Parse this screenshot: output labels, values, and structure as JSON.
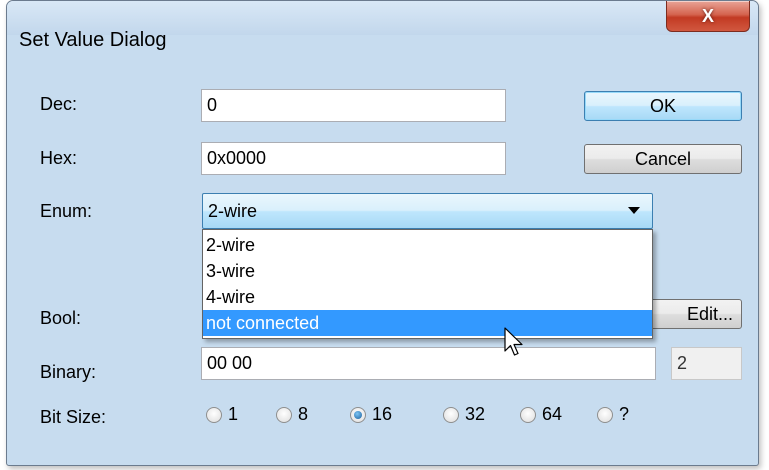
{
  "window": {
    "title": "Set Value Dialog",
    "close_glyph": "X"
  },
  "fields": {
    "dec": {
      "label": "Dec:",
      "value": "0"
    },
    "hex": {
      "label": "Hex:",
      "value": "0x0000"
    },
    "enum": {
      "label": "Enum:",
      "selected": "2-wire",
      "options": [
        "2-wire",
        "3-wire",
        "4-wire",
        "not connected"
      ],
      "highlighted_index": 3
    },
    "bool": {
      "label": "Bool:"
    },
    "binary": {
      "label": "Binary:",
      "value": "00 00",
      "size": "2"
    },
    "bit_size": {
      "label": "Bit Size:",
      "options": [
        "1",
        "8",
        "16",
        "32",
        "64",
        "?"
      ],
      "selected": "16"
    }
  },
  "buttons": {
    "ok": "OK",
    "cancel": "Cancel",
    "edit_visible": "Edit..."
  },
  "colors": {
    "selection": "#3399ff",
    "close_button": "#c23a23",
    "window_frame": "#c7dcef"
  }
}
